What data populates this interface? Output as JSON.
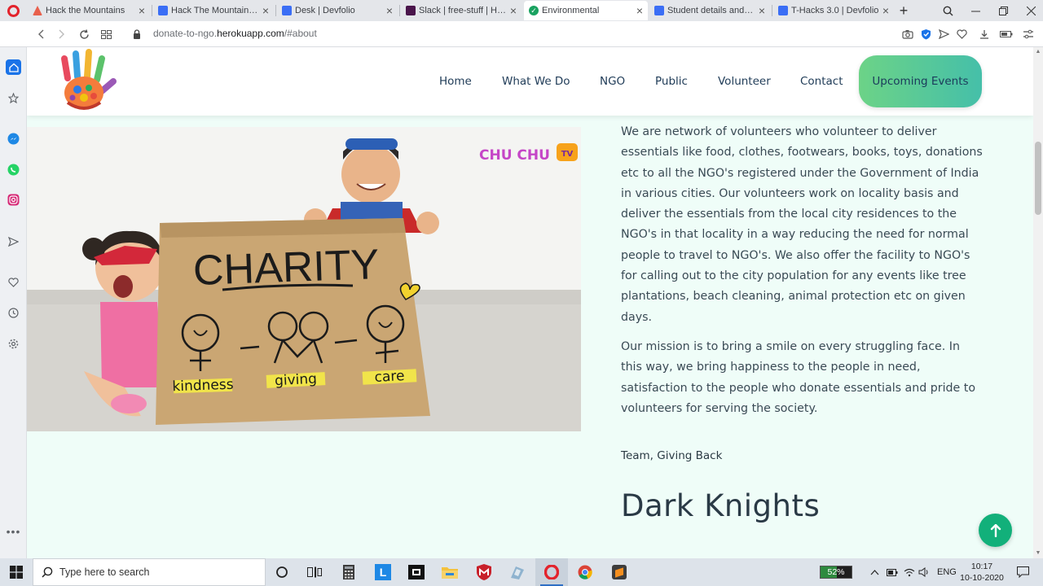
{
  "browser": {
    "tabs": [
      {
        "title": "Hack the Mountains",
        "fav_color": "#e8604c"
      },
      {
        "title": "Hack The Mountains: Da",
        "fav_color": "#3b6ef5"
      },
      {
        "title": "Desk | Devfolio",
        "fav_color": "#3b6ef5"
      },
      {
        "title": "Slack | free-stuff | Hack t",
        "fav_color": "#4a154b"
      },
      {
        "title": "Environmental",
        "fav_color": "#1aa260"
      },
      {
        "title": "Student details and doc",
        "fav_color": "#3b6ef5"
      },
      {
        "title": "T-Hacks 3.0 | Devfolio",
        "fav_color": "#3b6ef5"
      }
    ],
    "active_tab_index": 4,
    "url_prefix": "donate-to-ngo.",
    "url_domain": "herokuapp.com",
    "url_suffix": "/#about"
  },
  "site": {
    "nav": {
      "home": "Home",
      "what_we_do": "What We Do",
      "ngo": "NGO",
      "public": "Public",
      "volunteer": "Volunteer",
      "contact": "Contact",
      "upcoming_events": "Upcoming Events"
    },
    "image": {
      "sign_title": "CHARITY",
      "word1": "kindness",
      "word2": "giving",
      "word3": "care",
      "watermark": "CHU CHU",
      "watermark_badge": "TV"
    },
    "about": {
      "para1": "We are network of volunteers who volunteer to deliver essentials like food, clothes, footwears, books, toys, donations etc to all the NGO's registered under the Government of India in various cities. Our volunteers work on locality basis and deliver the essentials from the local city residences to the NGO's in that locality in a way reducing the need for normal people to travel to NGO's. We also offer the facility to NGO's for calling out to the city population for any events like tree plantations, beach cleaning, animal protection etc on given days.",
      "para2": "Our mission is to bring a smile on every struggling face. In this way, we bring happiness to the people in need, satisfaction to the people who donate essentials and pride to volunteers for serving the society.",
      "signature": "Team, Giving Back"
    },
    "team_title": "Dark Knights",
    "colors": {
      "accent_start": "#6cd387",
      "accent_end": "#45bfa9",
      "background": "#effdf8",
      "top_button": "#12b07a"
    }
  },
  "taskbar": {
    "search_placeholder": "Type here to search",
    "battery": "52%",
    "battery_level": 0.52,
    "language": "ENG",
    "time": "10:17",
    "date": "10-10-2020"
  }
}
